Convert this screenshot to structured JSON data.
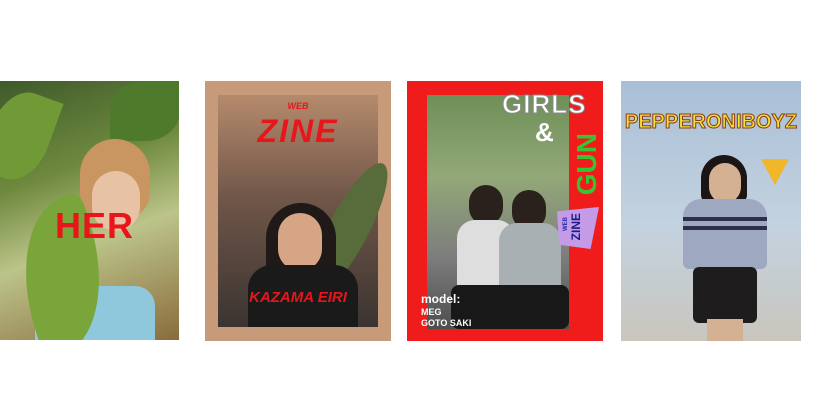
{
  "covers": [
    {
      "title": "HER",
      "title_color": "#e8161b"
    },
    {
      "top_label": "WEB",
      "title": "ZINE",
      "model_name": "KAZAMA EIRI",
      "title_color": "#e8161b"
    },
    {
      "title_top": "GIRLS",
      "ampersand": "&",
      "title_bottom": "GUN",
      "badge_top": "WEB",
      "badge_bottom": "ZINE",
      "model_label": "model:",
      "models": [
        "MEG",
        "GOTO SAKI"
      ],
      "frame_color": "#f01c1c",
      "accent_color": "#39c232"
    },
    {
      "title": "PEPPERONIBOYZ",
      "title_color": "#f2e23a",
      "icon": "pizza-slice-icon"
    }
  ]
}
